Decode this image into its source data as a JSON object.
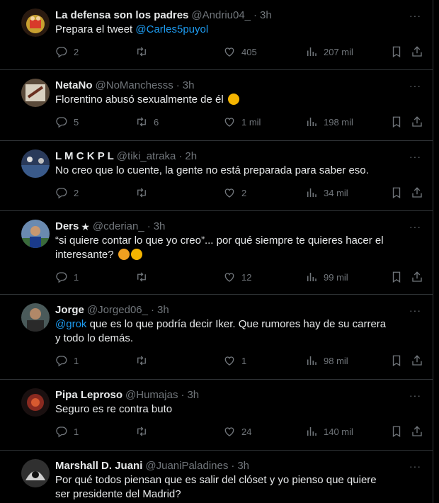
{
  "tweets": [
    {
      "name": "La defensa son los padres",
      "handle": "@Andriu04_",
      "time": "3h",
      "text": "Prepara el tweet ",
      "mention": "@Carles5puyol",
      "replies": "2",
      "retweets": "",
      "likes": "405",
      "views": "207 mil"
    },
    {
      "name": "NetaNo",
      "handle": "@NoManchesss",
      "time": "3h",
      "text": "Florentino abusó sexualmente de él",
      "emoji": "hushed-face",
      "replies": "5",
      "retweets": "6",
      "likes": "1 mil",
      "views": "198 mil"
    },
    {
      "name": "L M C K P L",
      "handle": "@tiki_atraka",
      "time": "2h",
      "text": "No creo que lo cuente, la gente no está preparada para saber eso.",
      "replies": "2",
      "retweets": "",
      "likes": "2",
      "views": "34 mil"
    },
    {
      "name": "Ders",
      "badge": "★",
      "handle": "@cderian_",
      "time": "3h",
      "text": "“si quiere contar lo que yo creo”... por qué siempre te quieres hacer el interesante?",
      "emoji": "hand-over-mouth, sleepy-face",
      "replies": "1",
      "retweets": "",
      "likes": "12",
      "views": "99 mil"
    },
    {
      "name": "Jorge",
      "handle": "@Jorged06_",
      "time": "3h",
      "mention": "@grok",
      "text": " que es lo que podría decir Iker. Que rumores hay de su carrera y todo lo demás.",
      "replies": "1",
      "retweets": "",
      "likes": "1",
      "views": "98 mil"
    },
    {
      "name": "Pipa Leproso",
      "handle": "@Humajas",
      "time": "3h",
      "text": "Seguro es re contra buto",
      "replies": "1",
      "retweets": "",
      "likes": "24",
      "views": "140 mil"
    },
    {
      "name": "Marshall D. Juani",
      "handle": "@JuaniPaladines",
      "time": "3h",
      "text": "Por qué todos piensan que es salir del clóset y yo pienso que quiere ser presidente del Madrid?",
      "replies": "",
      "retweets": "",
      "likes": "",
      "views": ""
    }
  ],
  "ui": {
    "more_glyph": "···",
    "separator": "·"
  },
  "colors": {
    "background": "#000000",
    "text": "#e7e9ea",
    "muted": "#71767b",
    "link": "#1d9bf0",
    "border": "#2f3336"
  }
}
